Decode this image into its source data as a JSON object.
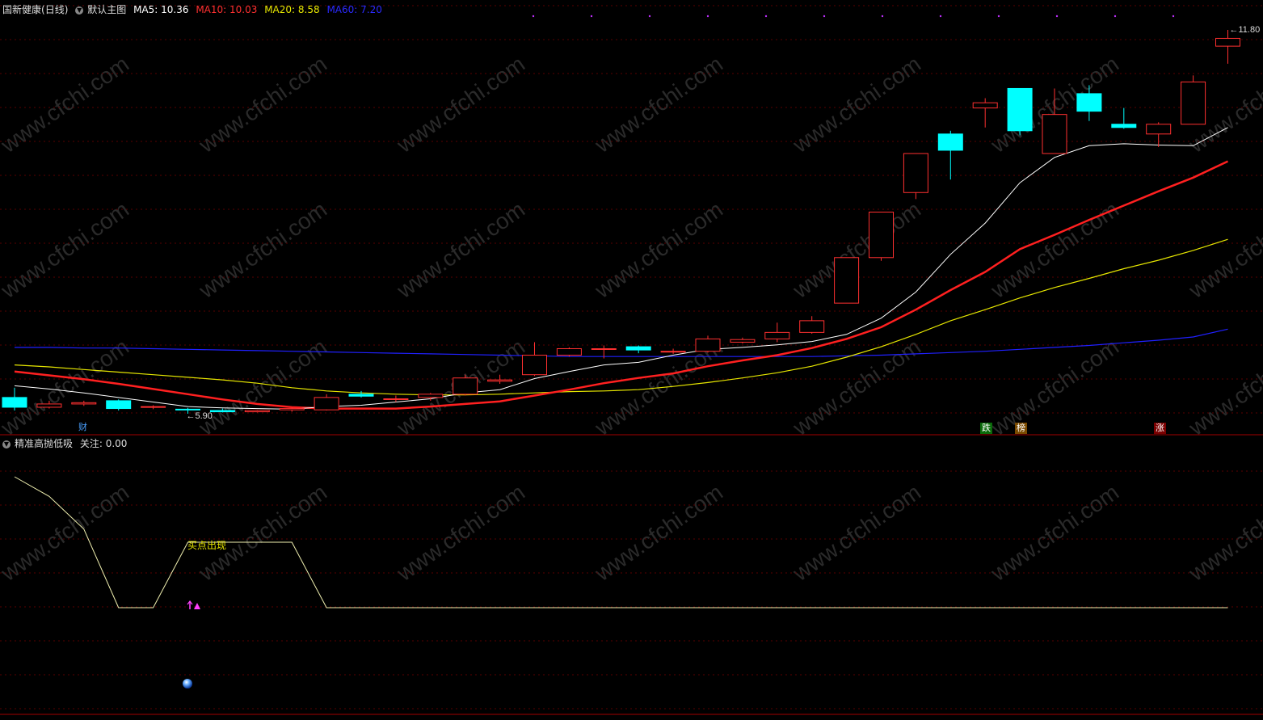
{
  "main_header": {
    "stock": "国新健康",
    "period": "(日线)",
    "chart_name": "默认主图",
    "ma5": "MA5: 10.36",
    "ma10": "MA10: 10.03",
    "ma20": "MA20: 8.58",
    "ma60": "MA60: 7.20"
  },
  "sub_header": {
    "indicator": "精准高抛低吸",
    "value": "关注: 0.00"
  },
  "annotations": {
    "low_label": "5.90",
    "high_label": "11.80",
    "buy_signal": "买点出现",
    "markers": [
      "财",
      "跌",
      "榜",
      "涨"
    ]
  },
  "watermark": "www.cfchi.com",
  "colors": {
    "up": "#ff3030",
    "down": "#00ffff",
    "ma5": "#ffffff",
    "ma10": "#ff2020",
    "ma20": "#e6e600",
    "ma60": "#2020ff",
    "grid": "#5a0000"
  },
  "chart_data": [
    {
      "type": "candlestick",
      "y_range": [
        5.9,
        11.8
      ],
      "candles": [
        {
          "o": 6.15,
          "h": 6.3,
          "l": 5.95,
          "c": 6.0
        },
        {
          "o": 6.0,
          "h": 6.1,
          "l": 5.98,
          "c": 6.05
        },
        {
          "o": 6.05,
          "h": 6.1,
          "l": 6.02,
          "c": 6.07
        },
        {
          "o": 6.1,
          "h": 6.12,
          "l": 5.95,
          "c": 5.98
        },
        {
          "o": 6.0,
          "h": 6.03,
          "l": 5.97,
          "c": 6.01
        },
        {
          "o": 5.97,
          "h": 5.99,
          "l": 5.9,
          "c": 5.96
        },
        {
          "o": 5.95,
          "h": 5.98,
          "l": 5.92,
          "c": 5.93
        },
        {
          "o": 5.93,
          "h": 5.96,
          "l": 5.92,
          "c": 5.95
        },
        {
          "o": 5.96,
          "h": 6.0,
          "l": 5.93,
          "c": 5.98
        },
        {
          "o": 5.96,
          "h": 6.2,
          "l": 5.95,
          "c": 6.15
        },
        {
          "o": 6.2,
          "h": 6.25,
          "l": 6.15,
          "c": 6.17
        },
        {
          "o": 6.12,
          "h": 6.18,
          "l": 6.08,
          "c": 6.13
        },
        {
          "o": 6.15,
          "h": 6.22,
          "l": 6.1,
          "c": 6.2
        },
        {
          "o": 6.2,
          "h": 6.5,
          "l": 6.18,
          "c": 6.45
        },
        {
          "o": 6.4,
          "h": 6.5,
          "l": 6.36,
          "c": 6.42
        },
        {
          "o": 6.5,
          "h": 7.0,
          "l": 6.48,
          "c": 6.8
        },
        {
          "o": 6.8,
          "h": 6.92,
          "l": 6.78,
          "c": 6.9
        },
        {
          "o": 6.9,
          "h": 6.95,
          "l": 6.75,
          "c": 6.9
        },
        {
          "o": 6.93,
          "h": 6.95,
          "l": 6.83,
          "c": 6.88
        },
        {
          "o": 6.86,
          "h": 6.9,
          "l": 6.82,
          "c": 6.86
        },
        {
          "o": 6.86,
          "h": 7.1,
          "l": 6.84,
          "c": 7.05
        },
        {
          "o": 7.0,
          "h": 7.07,
          "l": 6.98,
          "c": 7.04
        },
        {
          "o": 7.05,
          "h": 7.3,
          "l": 7.0,
          "c": 7.15
        },
        {
          "o": 7.15,
          "h": 7.4,
          "l": 7.13,
          "c": 7.33
        },
        {
          "o": 7.6,
          "h": 8.3,
          "l": 7.6,
          "c": 8.3
        },
        {
          "o": 8.3,
          "h": 9.0,
          "l": 8.25,
          "c": 9.0
        },
        {
          "o": 9.3,
          "h": 9.9,
          "l": 9.2,
          "c": 9.9
        },
        {
          "o": 10.2,
          "h": 10.25,
          "l": 9.5,
          "c": 9.95
        },
        {
          "o": 10.6,
          "h": 10.75,
          "l": 10.3,
          "c": 10.68
        },
        {
          "o": 10.9,
          "h": 10.9,
          "l": 10.18,
          "c": 10.25
        },
        {
          "o": 9.9,
          "h": 10.9,
          "l": 9.9,
          "c": 10.5
        },
        {
          "o": 10.82,
          "h": 10.95,
          "l": 10.4,
          "c": 10.55
        },
        {
          "o": 10.35,
          "h": 10.6,
          "l": 10.28,
          "c": 10.3
        },
        {
          "o": 10.2,
          "h": 10.38,
          "l": 10.0,
          "c": 10.35
        },
        {
          "o": 10.35,
          "h": 11.1,
          "l": 10.35,
          "c": 11.0
        },
        {
          "o": 11.55,
          "h": 11.8,
          "l": 11.28,
          "c": 11.67
        }
      ],
      "ma5": [
        6.33,
        6.28,
        6.22,
        6.15,
        6.08,
        6.01,
        5.99,
        5.98,
        5.97,
        6.01,
        6.03,
        6.08,
        6.13,
        6.22,
        6.27,
        6.44,
        6.55,
        6.65,
        6.69,
        6.8,
        6.89,
        6.92,
        6.96,
        7.01,
        7.12,
        7.37,
        7.77,
        8.35,
        8.83,
        9.45,
        9.84,
        10.02,
        10.05,
        10.03,
        10.02,
        10.3
      ],
      "ma10": [
        6.55,
        6.49,
        6.43,
        6.36,
        6.28,
        6.2,
        6.12,
        6.05,
        6.0,
        5.98,
        5.98,
        5.98,
        6.01,
        6.05,
        6.09,
        6.18,
        6.27,
        6.37,
        6.45,
        6.52,
        6.63,
        6.72,
        6.8,
        6.91,
        7.05,
        7.23,
        7.5,
        7.8,
        8.08,
        8.43,
        8.65,
        8.88,
        9.1,
        9.32,
        9.53,
        9.78
      ],
      "ma20": [
        6.65,
        6.62,
        6.58,
        6.54,
        6.5,
        6.46,
        6.42,
        6.37,
        6.3,
        6.25,
        6.22,
        6.2,
        6.19,
        6.19,
        6.2,
        6.22,
        6.24,
        6.25,
        6.27,
        6.32,
        6.38,
        6.45,
        6.53,
        6.63,
        6.77,
        6.93,
        7.12,
        7.33,
        7.5,
        7.68,
        7.84,
        7.98,
        8.13,
        8.26,
        8.41,
        8.58
      ],
      "ma60": [
        6.92,
        6.92,
        6.91,
        6.91,
        6.9,
        6.89,
        6.88,
        6.87,
        6.86,
        6.85,
        6.84,
        6.83,
        6.82,
        6.81,
        6.8,
        6.79,
        6.78,
        6.78,
        6.78,
        6.78,
        6.78,
        6.78,
        6.78,
        6.78,
        6.79,
        6.8,
        6.82,
        6.84,
        6.86,
        6.89,
        6.92,
        6.95,
        6.99,
        7.03,
        7.08,
        7.2
      ]
    },
    {
      "type": "line",
      "name": "精准高抛低吸",
      "values": [
        100,
        85,
        60,
        0,
        0,
        50,
        50,
        50,
        50,
        0,
        0,
        0,
        0,
        0,
        0,
        0,
        0,
        0,
        0,
        0,
        0,
        0,
        0,
        0,
        0,
        0,
        0,
        0,
        0,
        0,
        0,
        0,
        0,
        0,
        0,
        0
      ],
      "y_range": [
        0,
        100
      ]
    }
  ]
}
